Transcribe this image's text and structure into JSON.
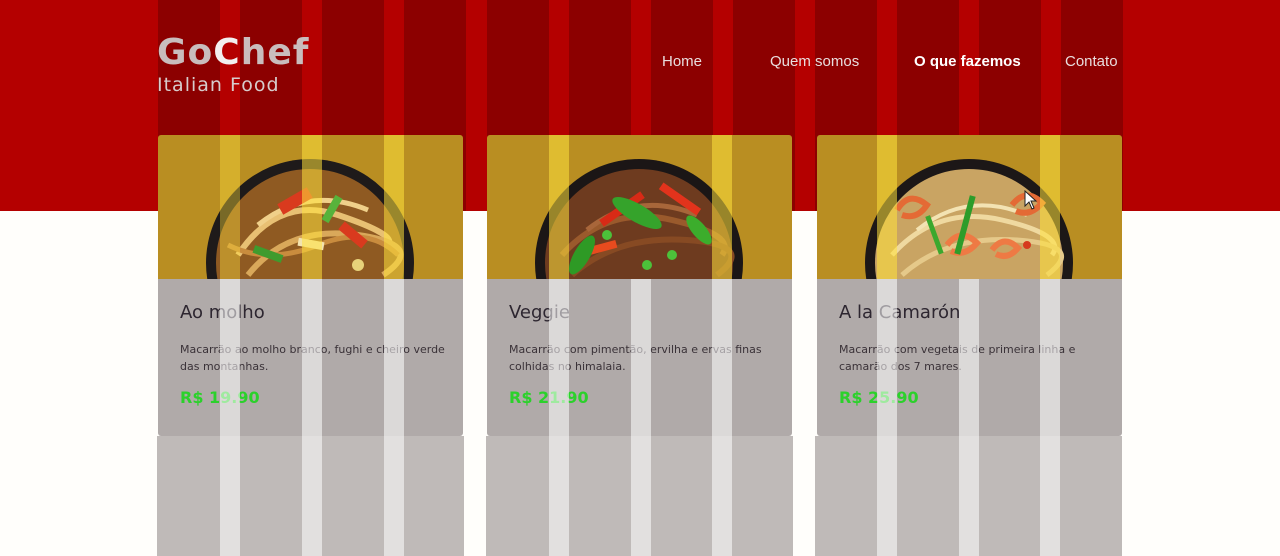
{
  "brand": {
    "title_pre": "Go",
    "title_hi": "C",
    "title_post": "hef",
    "subtitle": "Italian Food"
  },
  "nav": {
    "items": [
      {
        "label": "Home"
      },
      {
        "label": "Quem somos"
      },
      {
        "label": "O que fazemos",
        "active": true
      },
      {
        "label": "Contato"
      }
    ]
  },
  "menu": {
    "cards": [
      {
        "name": "Ao molho",
        "description": "Macarrão ao molho branco, fughi e cheiro verde das montanhas.",
        "price": "R$ 19.90",
        "image_icon": "noodle-bowl-icon"
      },
      {
        "name": "Veggie",
        "description": "Macarrão com pimentão, ervilha e ervas finas colhidas no himalaia.",
        "price": "R$ 21.90",
        "image_icon": "noodle-bowl-icon"
      },
      {
        "name": "A la Camarón",
        "description": "Macarrão com vegetais de primeira linha e camarão dos 7 mares.",
        "price": "R$ 25.90",
        "image_icon": "noodle-bowl-icon"
      }
    ]
  },
  "colors": {
    "hero": "#b40000",
    "card_image_bg": "#b98e22",
    "card_body": "#b0aaa9",
    "price": "#2bd12b"
  }
}
